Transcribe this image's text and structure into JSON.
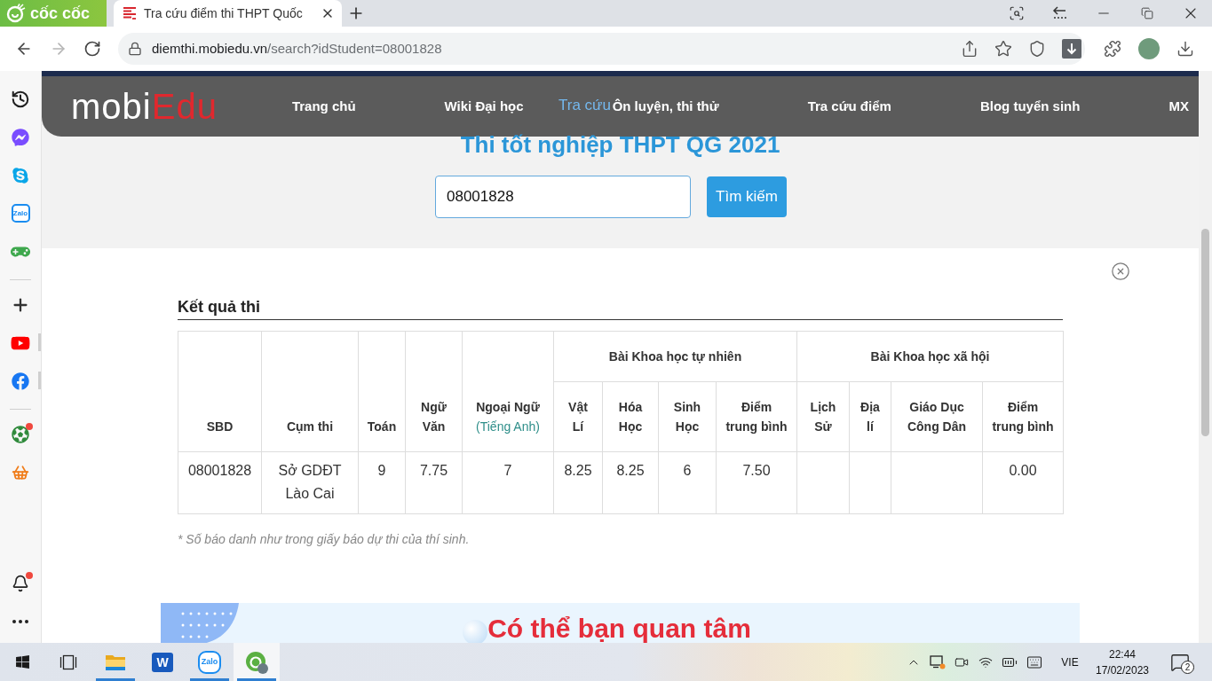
{
  "browser": {
    "brand": "cốc cốc",
    "tab": {
      "title": "Tra cứu điểm thi THPT Quốc"
    },
    "forward_enabled": false,
    "url": {
      "host": "diemthi.mobiedu.vn",
      "path": "/search?idStudent=08001828"
    }
  },
  "sidebar": {
    "groups": [
      {
        "items": [
          {
            "kind": "history",
            "badge": false,
            "open": false
          },
          {
            "kind": "messenger",
            "badge": false,
            "open": false
          },
          {
            "kind": "skype",
            "badge": false,
            "open": false
          },
          {
            "kind": "zalo",
            "text": "Zalo",
            "badge": false,
            "open": false
          },
          {
            "kind": "game",
            "badge": false,
            "open": false
          }
        ]
      },
      {
        "items": [
          {
            "kind": "plus",
            "badge": false,
            "open": false
          },
          {
            "kind": "youtube",
            "badge": false,
            "open": true
          },
          {
            "kind": "facebook",
            "badge": false,
            "open": true
          }
        ]
      },
      {
        "items": [
          {
            "kind": "soccer",
            "badge": true,
            "open": false
          },
          {
            "kind": "shop",
            "badge": false,
            "open": false
          }
        ]
      }
    ],
    "bottom": [
      {
        "kind": "bell",
        "badge": true,
        "open": false
      },
      {
        "kind": "more",
        "badge": false,
        "open": false
      }
    ]
  },
  "site": {
    "logo": {
      "text_1": "mobi",
      "text_2": "Edu"
    },
    "nav": [
      {
        "label": "Trang chủ"
      },
      {
        "label": "Wiki Đại học"
      },
      {
        "label": "Ôn luyện, thi thử"
      },
      {
        "label": "Tra cứu điểm"
      },
      {
        "label": "Blog tuyển sinh"
      },
      {
        "label": "MX"
      }
    ],
    "heading_behind_nav": "Tra cứu",
    "title": "Thi tốt nghiệp THPT QG 2021",
    "search": {
      "value": "08001828",
      "button": "Tìm kiếm"
    }
  },
  "results": {
    "heading": "Kết quả thi",
    "table": {
      "header": [
        {
          "label": "SBD"
        },
        {
          "label": "Cụm thi"
        },
        {
          "label": "Toán"
        },
        {
          "label": "Ngữ Văn"
        },
        {
          "label": "Ngoại Ngữ",
          "note": "(Tiếng Anh)"
        },
        {
          "label": "Bài Khoa học tự nhiên",
          "children": [
            {
              "label": "Vật Lí"
            },
            {
              "label": "Hóa Học"
            },
            {
              "label": "Sinh Học"
            },
            {
              "label": "Điểm trung bình"
            }
          ]
        },
        {
          "label": "Bài Khoa học xã hội",
          "children": [
            {
              "label": "Lịch Sử"
            },
            {
              "label": "Địa lí"
            },
            {
              "label": "Giáo Dục Công Dân"
            },
            {
              "label": "Điểm trung bình"
            }
          ]
        }
      ],
      "rows": [
        [
          "08001828",
          "Sở GDĐT Lào Cai",
          "9",
          "7.75",
          "7",
          "8.25",
          "8.25",
          "6",
          "7.50",
          null,
          null,
          null,
          "0.00"
        ]
      ]
    },
    "note": "* Số báo danh như trong giấy báo dự thi của thí sinh."
  },
  "banner": {
    "title": "Có thể bạn quan tâm"
  },
  "taskbar": {
    "apps": [
      {
        "kind": "start",
        "running": false,
        "selected": false
      },
      {
        "kind": "task-view",
        "running": false,
        "selected": false
      },
      {
        "kind": "explorer",
        "running": true,
        "selected": false
      },
      {
        "kind": "word",
        "text": "W",
        "running": false,
        "selected": false
      },
      {
        "kind": "zalo",
        "text": "Zalo",
        "running": true,
        "selected": false
      },
      {
        "kind": "browser",
        "running": true,
        "selected": true
      }
    ],
    "tray": {
      "language": "VIE",
      "time": "22:44",
      "date": "17/02/2023",
      "notifications": "2"
    }
  }
}
